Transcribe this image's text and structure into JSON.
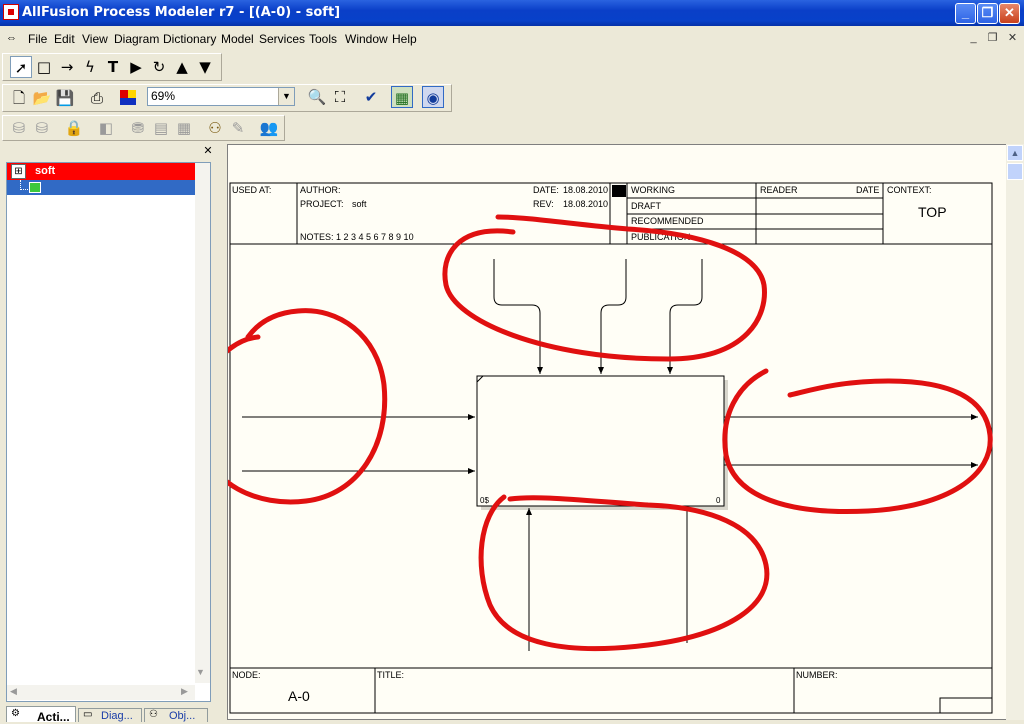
{
  "window": {
    "title": "AllFusion Process Modeler r7 - [(A-0)  - soft]"
  },
  "menu": [
    "File",
    "Edit",
    "View",
    "Diagram",
    "Dictionary",
    "Model",
    "Services",
    "Tools",
    "Window",
    "Help"
  ],
  "toolbar": {
    "zoom": "69%"
  },
  "tree": {
    "root_label": "soft"
  },
  "tabs": [
    "Acti...",
    "Diag...",
    "Obj..."
  ],
  "diagram": {
    "header": {
      "used_at": "USED AT:",
      "author": "AUTHOR:",
      "project_label": "PROJECT:",
      "project": "soft",
      "date_label": "DATE:",
      "date": "18.08.2010",
      "rev_label": "REV:",
      "rev": "18.08.2010",
      "notes": "NOTES:  1  2  3  4  5  6  7  8  9  10",
      "working": "WORKING",
      "draft": "DRAFT",
      "recommended": "RECOMMENDED",
      "publication": "PUBLICATION",
      "reader": "READER",
      "reader_date": "DATE",
      "context_label": "CONTEXT:",
      "context": "TOP"
    },
    "box_cost": "0$",
    "box_number": "0",
    "footer": {
      "node_label": "NODE:",
      "node": "A-0",
      "title_label": "TITLE:",
      "number_label": "NUMBER:"
    }
  }
}
